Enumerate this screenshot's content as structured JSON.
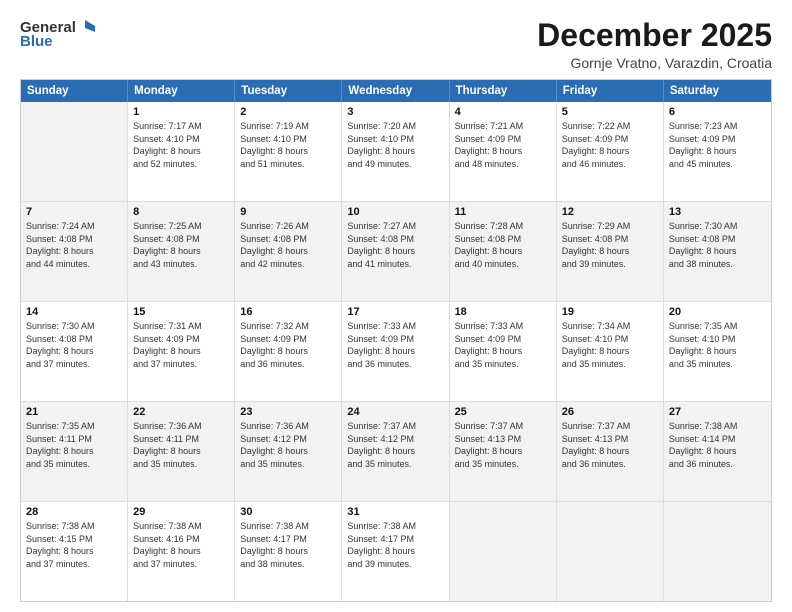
{
  "logo": {
    "line1": "General",
    "line2": "Blue"
  },
  "title": "December 2025",
  "subtitle": "Gornje Vratno, Varazdin, Croatia",
  "header_days": [
    "Sunday",
    "Monday",
    "Tuesday",
    "Wednesday",
    "Thursday",
    "Friday",
    "Saturday"
  ],
  "weeks": [
    [
      {
        "day": "",
        "text": ""
      },
      {
        "day": "1",
        "text": "Sunrise: 7:17 AM\nSunset: 4:10 PM\nDaylight: 8 hours\nand 52 minutes."
      },
      {
        "day": "2",
        "text": "Sunrise: 7:19 AM\nSunset: 4:10 PM\nDaylight: 8 hours\nand 51 minutes."
      },
      {
        "day": "3",
        "text": "Sunrise: 7:20 AM\nSunset: 4:10 PM\nDaylight: 8 hours\nand 49 minutes."
      },
      {
        "day": "4",
        "text": "Sunrise: 7:21 AM\nSunset: 4:09 PM\nDaylight: 8 hours\nand 48 minutes."
      },
      {
        "day": "5",
        "text": "Sunrise: 7:22 AM\nSunset: 4:09 PM\nDaylight: 8 hours\nand 46 minutes."
      },
      {
        "day": "6",
        "text": "Sunrise: 7:23 AM\nSunset: 4:09 PM\nDaylight: 8 hours\nand 45 minutes."
      }
    ],
    [
      {
        "day": "7",
        "text": "Sunrise: 7:24 AM\nSunset: 4:08 PM\nDaylight: 8 hours\nand 44 minutes."
      },
      {
        "day": "8",
        "text": "Sunrise: 7:25 AM\nSunset: 4:08 PM\nDaylight: 8 hours\nand 43 minutes."
      },
      {
        "day": "9",
        "text": "Sunrise: 7:26 AM\nSunset: 4:08 PM\nDaylight: 8 hours\nand 42 minutes."
      },
      {
        "day": "10",
        "text": "Sunrise: 7:27 AM\nSunset: 4:08 PM\nDaylight: 8 hours\nand 41 minutes."
      },
      {
        "day": "11",
        "text": "Sunrise: 7:28 AM\nSunset: 4:08 PM\nDaylight: 8 hours\nand 40 minutes."
      },
      {
        "day": "12",
        "text": "Sunrise: 7:29 AM\nSunset: 4:08 PM\nDaylight: 8 hours\nand 39 minutes."
      },
      {
        "day": "13",
        "text": "Sunrise: 7:30 AM\nSunset: 4:08 PM\nDaylight: 8 hours\nand 38 minutes."
      }
    ],
    [
      {
        "day": "14",
        "text": "Sunrise: 7:30 AM\nSunset: 4:08 PM\nDaylight: 8 hours\nand 37 minutes."
      },
      {
        "day": "15",
        "text": "Sunrise: 7:31 AM\nSunset: 4:09 PM\nDaylight: 8 hours\nand 37 minutes."
      },
      {
        "day": "16",
        "text": "Sunrise: 7:32 AM\nSunset: 4:09 PM\nDaylight: 8 hours\nand 36 minutes."
      },
      {
        "day": "17",
        "text": "Sunrise: 7:33 AM\nSunset: 4:09 PM\nDaylight: 8 hours\nand 36 minutes."
      },
      {
        "day": "18",
        "text": "Sunrise: 7:33 AM\nSunset: 4:09 PM\nDaylight: 8 hours\nand 35 minutes."
      },
      {
        "day": "19",
        "text": "Sunrise: 7:34 AM\nSunset: 4:10 PM\nDaylight: 8 hours\nand 35 minutes."
      },
      {
        "day": "20",
        "text": "Sunrise: 7:35 AM\nSunset: 4:10 PM\nDaylight: 8 hours\nand 35 minutes."
      }
    ],
    [
      {
        "day": "21",
        "text": "Sunrise: 7:35 AM\nSunset: 4:11 PM\nDaylight: 8 hours\nand 35 minutes."
      },
      {
        "day": "22",
        "text": "Sunrise: 7:36 AM\nSunset: 4:11 PM\nDaylight: 8 hours\nand 35 minutes."
      },
      {
        "day": "23",
        "text": "Sunrise: 7:36 AM\nSunset: 4:12 PM\nDaylight: 8 hours\nand 35 minutes."
      },
      {
        "day": "24",
        "text": "Sunrise: 7:37 AM\nSunset: 4:12 PM\nDaylight: 8 hours\nand 35 minutes."
      },
      {
        "day": "25",
        "text": "Sunrise: 7:37 AM\nSunset: 4:13 PM\nDaylight: 8 hours\nand 35 minutes."
      },
      {
        "day": "26",
        "text": "Sunrise: 7:37 AM\nSunset: 4:13 PM\nDaylight: 8 hours\nand 36 minutes."
      },
      {
        "day": "27",
        "text": "Sunrise: 7:38 AM\nSunset: 4:14 PM\nDaylight: 8 hours\nand 36 minutes."
      }
    ],
    [
      {
        "day": "28",
        "text": "Sunrise: 7:38 AM\nSunset: 4:15 PM\nDaylight: 8 hours\nand 37 minutes."
      },
      {
        "day": "29",
        "text": "Sunrise: 7:38 AM\nSunset: 4:16 PM\nDaylight: 8 hours\nand 37 minutes."
      },
      {
        "day": "30",
        "text": "Sunrise: 7:38 AM\nSunset: 4:17 PM\nDaylight: 8 hours\nand 38 minutes."
      },
      {
        "day": "31",
        "text": "Sunrise: 7:38 AM\nSunset: 4:17 PM\nDaylight: 8 hours\nand 39 minutes."
      },
      {
        "day": "",
        "text": ""
      },
      {
        "day": "",
        "text": ""
      },
      {
        "day": "",
        "text": ""
      }
    ]
  ]
}
